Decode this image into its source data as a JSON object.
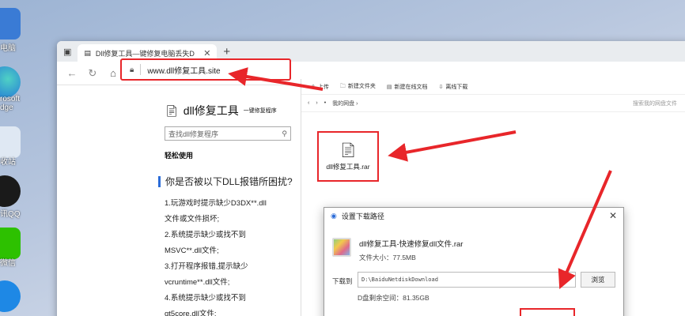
{
  "desktop": {
    "icons": [
      {
        "label": "电脑",
        "icon": "computer-icon"
      },
      {
        "label": "rosoft\ndge",
        "icon": "edge-icon"
      },
      {
        "label": "收站",
        "icon": "recycle-bin-icon"
      },
      {
        "label": "讯QQ",
        "icon": "qq-icon"
      },
      {
        "label": "微信",
        "icon": "wechat-icon"
      }
    ]
  },
  "browser": {
    "tab_title": "Dll修复工具—键修复电脑丢失D",
    "new_tab": "+",
    "url": "www.dll修复工具.site"
  },
  "article": {
    "title": "dll修复工具",
    "title_suffix": "一键修复程序",
    "search_placeholder": "查找dll修复程序",
    "section": "轻松使用",
    "question": "你是否被以下DLL报错所困扰?",
    "lines": [
      "1.玩游戏时提示缺少D3DX**.dll",
      "文件或文件损坏;",
      "2.系统提示缺少或找不到",
      "MSVC**.dll文件;",
      "3.打开程序报错,提示缺少",
      "vcruntime**.dll文件;",
      "4.系统提示缺少或找不到",
      "qt5core.dll文件;"
    ]
  },
  "netdisk": {
    "toolbar": [
      "上传",
      "新建文件夹",
      "新建在线文档",
      "离线下载"
    ],
    "breadcrumb": "我的网盘",
    "search_placeholder": "搜索我的网盘文件",
    "file_name": "dll修复工具.rar"
  },
  "dialog": {
    "title": "设置下载路径",
    "file_name": "dll修复工具-快速修复dll文件.rar",
    "file_size": "文件大小：77.5MB",
    "download_label": "下载到",
    "path": "D:\\BaiduNetdiskDownload",
    "browse": "浏览",
    "free_space": "D盘剩余空间：81.35GB"
  },
  "colors": {
    "accent_red": "#e8262a",
    "link_blue": "#2b6cd8"
  }
}
